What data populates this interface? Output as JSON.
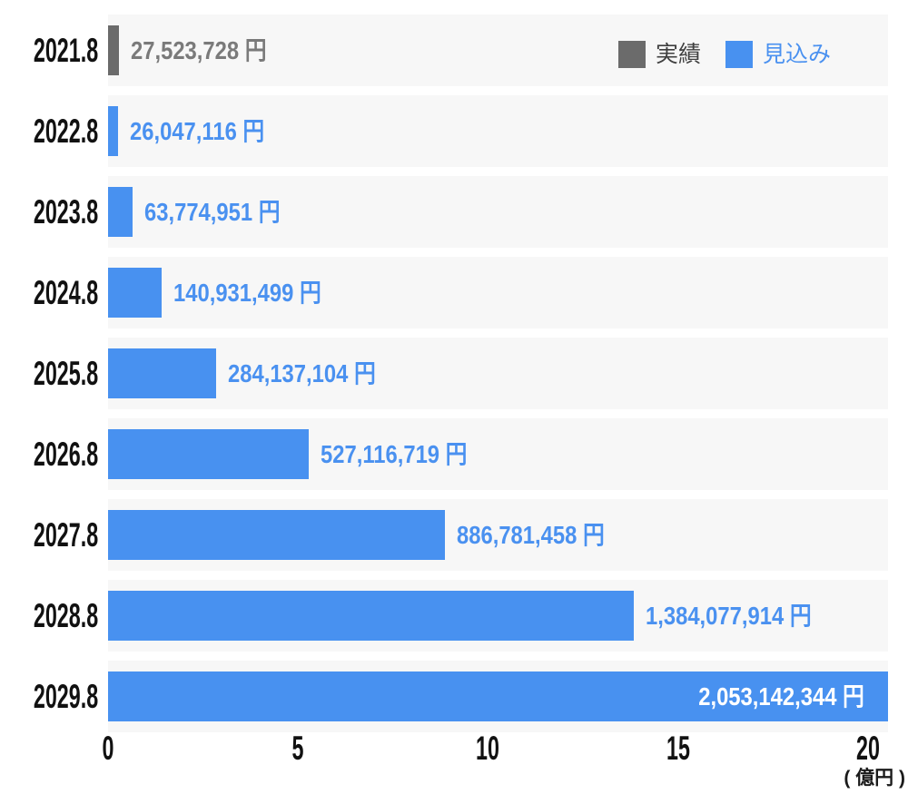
{
  "chart_data": {
    "type": "bar",
    "orientation": "horizontal",
    "title": "",
    "unit_label": "( 億円 )",
    "x_axis": {
      "ticks": [
        0,
        5,
        10,
        15,
        20
      ],
      "tick_unit_oku": 100000000,
      "max_value_yen": 2053142344,
      "grid": false
    },
    "legend": [
      {
        "label": "実績",
        "color": "#6B6B6B",
        "value_text_color": "#7A7A7A",
        "label_text_color": "#3F3F3F"
      },
      {
        "label": "見込み",
        "color": "#4891F0",
        "value_text_color": "#4A91F0",
        "label_text_color": "#4A91F0"
      }
    ],
    "rows": [
      {
        "category": "2021.8",
        "value_yen": 27523728,
        "value_label": "27,523,728 円",
        "series": "実績",
        "label_inside": false
      },
      {
        "category": "2022.8",
        "value_yen": 26047116,
        "value_label": "26,047,116 円",
        "series": "見込み",
        "label_inside": false
      },
      {
        "category": "2023.8",
        "value_yen": 63774951,
        "value_label": "63,774,951 円",
        "series": "見込み",
        "label_inside": false
      },
      {
        "category": "2024.8",
        "value_yen": 140931499,
        "value_label": "140,931,499 円",
        "series": "見込み",
        "label_inside": false
      },
      {
        "category": "2025.8",
        "value_yen": 284137104,
        "value_label": "284,137,104 円",
        "series": "見込み",
        "label_inside": false
      },
      {
        "category": "2026.8",
        "value_yen": 527116719,
        "value_label": "527,116,719 円",
        "series": "見込み",
        "label_inside": false
      },
      {
        "category": "2027.8",
        "value_yen": 886781458,
        "value_label": "886,781,458 円",
        "series": "見込み",
        "label_inside": false
      },
      {
        "category": "2028.8",
        "value_yen": 1384077914,
        "value_label": "1,384,077,914 円",
        "series": "見込み",
        "label_inside": false
      },
      {
        "category": "2029.8",
        "value_yen": 2053142344,
        "value_label": "2,053,142,344 円",
        "series": "見込み",
        "label_inside": true
      }
    ],
    "colors": {
      "track_background": "#F7F7F7",
      "page_background": "#FFFFFF",
      "axis_text": "#111111"
    }
  }
}
